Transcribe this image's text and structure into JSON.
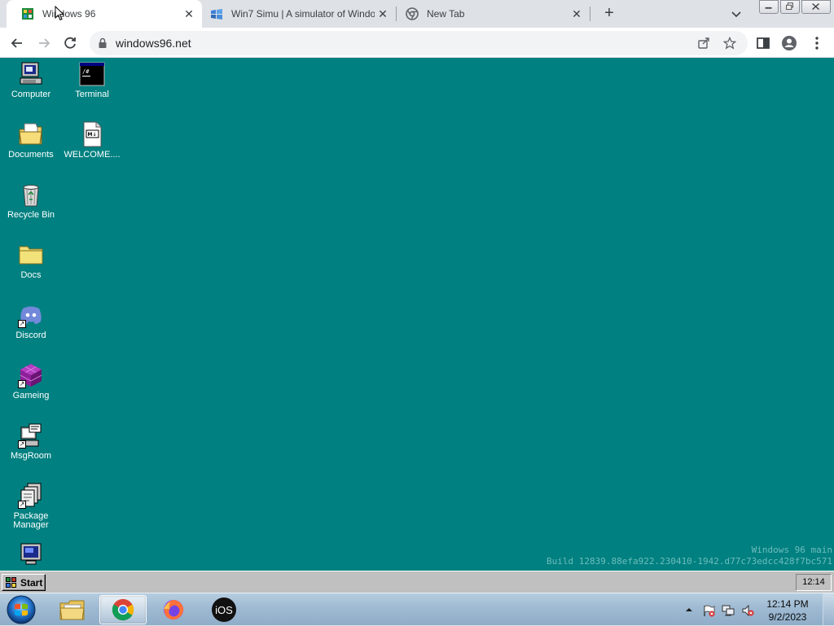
{
  "browser": {
    "tabs": [
      {
        "title": "Windows 96",
        "active": true
      },
      {
        "title": "Win7 Simu | A simulator of Windows",
        "active": false
      },
      {
        "title": "New Tab",
        "active": false
      }
    ],
    "url": "windows96.net"
  },
  "desktop": {
    "background_color": "#008080",
    "icons": [
      {
        "label": "Computer",
        "icon": "computer-icon"
      },
      {
        "label": "Terminal",
        "icon": "terminal-icon"
      },
      {
        "label": "Documents",
        "icon": "documents-folder-icon"
      },
      {
        "label": "WELCOME....",
        "icon": "markdown-file-icon"
      },
      {
        "label": "Recycle Bin",
        "icon": "recycle-bin-icon"
      },
      {
        "label": "Docs",
        "icon": "folder-icon"
      },
      {
        "label": "Discord",
        "icon": "discord-icon"
      },
      {
        "label": "Gameing",
        "icon": "cube-icon"
      },
      {
        "label": "MsgRoom",
        "icon": "msgroom-icon"
      },
      {
        "label": "Package Manager",
        "icon": "package-manager-icon"
      },
      {
        "label": "",
        "icon": "monitor-icon"
      }
    ],
    "build_line1": "Windows 96 main",
    "build_line2": "Build 12839.88efa922.230410-1942.d77c73edcc428f7bc571"
  },
  "w96_taskbar": {
    "start_label": "Start",
    "clock": "12:14"
  },
  "win7_taskbar": {
    "apps": [
      "Windows Explorer",
      "Google Chrome",
      "Firefox",
      "iOS"
    ],
    "time": "12:14 PM",
    "date": "9/2/2023"
  }
}
